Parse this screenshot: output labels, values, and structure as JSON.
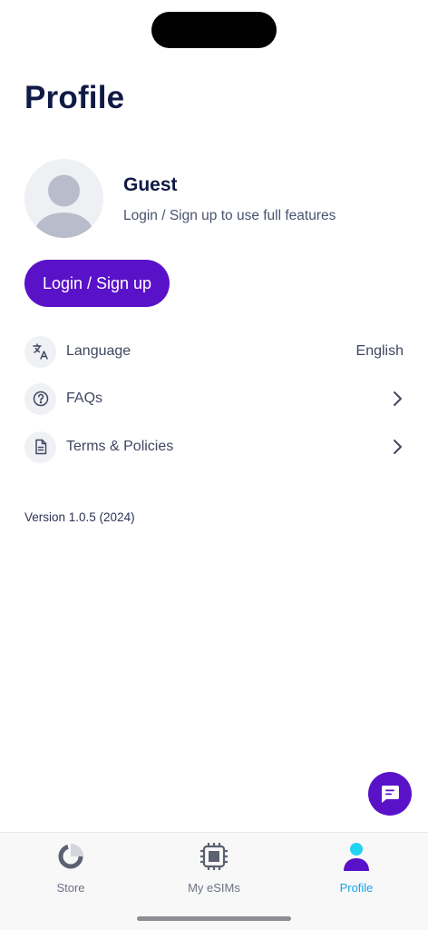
{
  "header": {
    "title": "Profile"
  },
  "profile": {
    "name": "Guest",
    "subtitle": "Login / Sign up to use full features",
    "avatar_icon": "user-silhouette-icon"
  },
  "login_button": {
    "label": "Login / Sign up"
  },
  "menu": [
    {
      "icon": "translate-icon",
      "label": "Language",
      "value": "English"
    },
    {
      "icon": "help-circle-icon",
      "label": "FAQs",
      "trailing": "chevron-right-icon"
    },
    {
      "icon": "document-icon",
      "label": "Terms & Policies",
      "trailing": "chevron-right-icon"
    }
  ],
  "version": "Version 1.0.5 (2024)",
  "chat": {
    "icon": "chat-bubble-icon"
  },
  "tabs": [
    {
      "label": "Store",
      "icon": "store-icon",
      "active": false
    },
    {
      "label": "My eSIMs",
      "icon": "sim-chip-icon",
      "active": false
    },
    {
      "label": "Profile",
      "icon": "profile-icon",
      "active": true
    }
  ],
  "colors": {
    "brand": "#5a12c9",
    "active_tab": "#1aa3e8",
    "title": "#111a45",
    "text": "#3f4660"
  }
}
